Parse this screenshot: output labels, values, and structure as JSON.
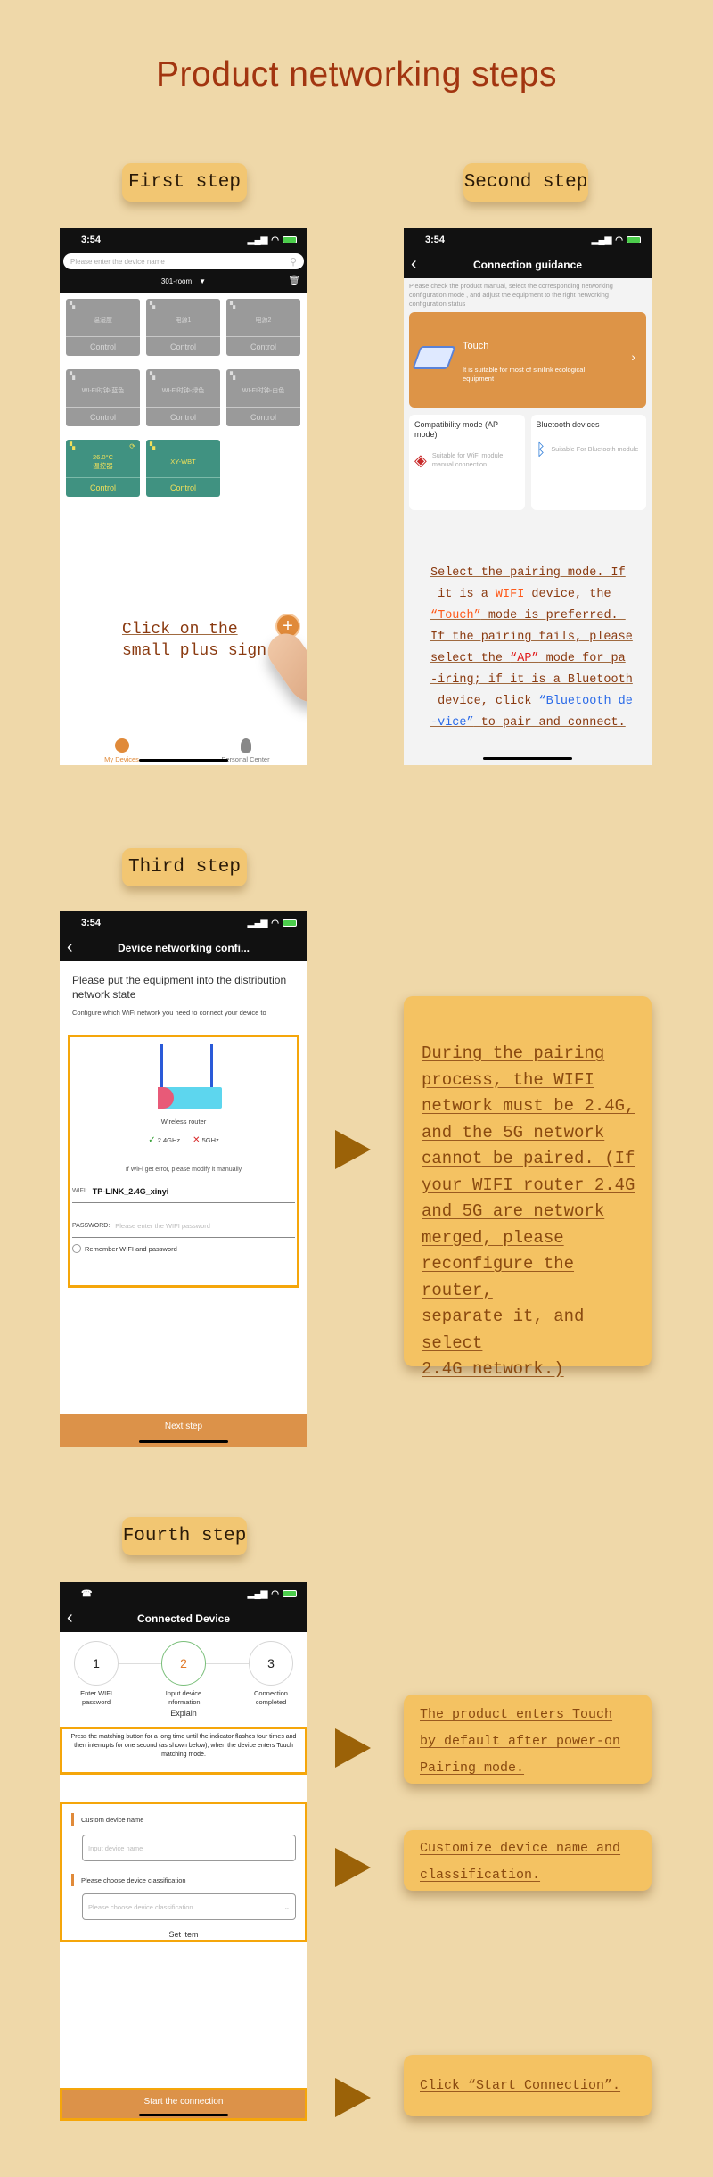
{
  "title": "Product networking steps",
  "steps": {
    "first": "First step",
    "second": "Second step",
    "third": "Third step",
    "fourth": "Fourth step"
  },
  "colors": {
    "background": "#efd8a9",
    "title": "#a23510",
    "badge": "#f2c672",
    "accent_orange": "#dc9249",
    "highlight_border": "#f5a60a",
    "arrow": "#9b6208",
    "tile_gray": "#9a9a9a",
    "tile_green": "#409281"
  },
  "screen1": {
    "time": "3:54",
    "search_placeholder": "Please enter the device name",
    "room": "301-room",
    "devices": [
      {
        "name": "温湿度",
        "control": "Control",
        "state": "offline"
      },
      {
        "name": "电源1",
        "control": "Control",
        "state": "offline"
      },
      {
        "name": "电源2",
        "control": "Control",
        "state": "offline"
      },
      {
        "name": "WI-FI时钟-蓝色",
        "control": "Control",
        "state": "offline"
      },
      {
        "name": "WI-FI时钟-绿色",
        "control": "Control",
        "state": "offline"
      },
      {
        "name": "WI-FI时钟-白色",
        "control": "Control",
        "state": "offline"
      },
      {
        "value": "26.0°C",
        "name": "温控器",
        "control": "Control",
        "state": "online"
      },
      {
        "name": "XY-WBT",
        "control": "Control",
        "state": "online"
      }
    ],
    "annotation_line1": "Click on the",
    "annotation_line2": "small plus sign",
    "tabs": [
      "My Devices",
      "Personal Center"
    ]
  },
  "screen2": {
    "time": "3:54",
    "nav_title": "Connection guidance",
    "description": "Please check the product manual, select the corresponding networking configuration mode , and adjust the equipment to the right networking configuration status",
    "touch_title": "Touch",
    "touch_desc": "It is suitable for most of sinilink ecological equipment",
    "ap_title": "Compatibility mode (AP mode)",
    "ap_desc": "Suitable for WiFi module manual connection",
    "bt_title": "Bluetooth devices",
    "bt_desc": "Suitable For Bluetooth module",
    "annotation": [
      [
        {
          "t": "Select the pairing mode. If"
        }
      ],
      [
        {
          "t": " it is a "
        },
        {
          "t": "WIFI",
          "c": "orange"
        },
        {
          "t": " device, the "
        }
      ],
      [
        {
          "t": "“Touch”",
          "c": "orange"
        },
        {
          "t": " mode is preferred. "
        }
      ],
      [
        {
          "t": "If the pairing fails, please"
        }
      ],
      [
        {
          "t": "select the "
        },
        {
          "t": "“AP”",
          "c": "red"
        },
        {
          "t": " mode for pa"
        }
      ],
      [
        {
          "t": "-iring; if it is a Bluetooth"
        }
      ],
      [
        {
          "t": " device, click "
        },
        {
          "t": "“Bluetooth de",
          "c": "blue"
        }
      ],
      [
        {
          "t": "-vice”",
          "c": "blue"
        },
        {
          "t": " to pair and connect."
        }
      ]
    ]
  },
  "screen3": {
    "time": "3:54",
    "nav_title": "Device networking confi...",
    "heading": "Please put the equipment into the distribution network state",
    "subheading": "Configure which WiFi network you need to connect your device to",
    "router_label": "Wireless router",
    "band_ok": "2.4GHz",
    "band_bad": "5GHz",
    "error_hint": "If WiFi get error, please modify it manually",
    "wifi_label": "WIFI:",
    "wifi_value": "TP-LINK_2.4G_xinyi",
    "password_label": "PASSWORD:",
    "password_placeholder": "Please enter the WIFI password",
    "remember_label": "Remember WIFI and password",
    "remember_checked": false,
    "next_button": "Next step"
  },
  "note3": [
    "During the pairing",
    "process, the WIFI",
    "network must be 2.4G,",
    "and the 5G network",
    "cannot be paired. (If",
    "your WIFI router 2.4G",
    "and 5G are network",
    "merged, please",
    "reconfigure the router,",
    "separate it, and select",
    "2.4G network.)"
  ],
  "screen4": {
    "nav_title": "Connected Device",
    "steps": [
      {
        "num": "1",
        "label": "Enter WIFI\npassword"
      },
      {
        "num": "2",
        "label": "Input device\ninformation",
        "active": true
      },
      {
        "num": "3",
        "label": "Connection\ncompleted"
      }
    ],
    "explain_title": "Explain",
    "explain_text": "Press the matching button for a long time until the indicator flashes four times and then interrupts for one second (as shown below), when the device enters Touch matching mode.",
    "set_item_title": "Set item",
    "custom_name_label": "Custom device name",
    "custom_name_placeholder": "Input device name",
    "classification_label": "Please choose device classification",
    "classification_placeholder": "Please choose device classification",
    "start_button": "Start the connection"
  },
  "notes4": {
    "touch_default": [
      "The product enters Touch",
      "by default after power-on",
      "Pairing mode."
    ],
    "customize": [
      "Customize device name and",
      "classification."
    ],
    "start": [
      "Click “Start Connection”."
    ]
  }
}
